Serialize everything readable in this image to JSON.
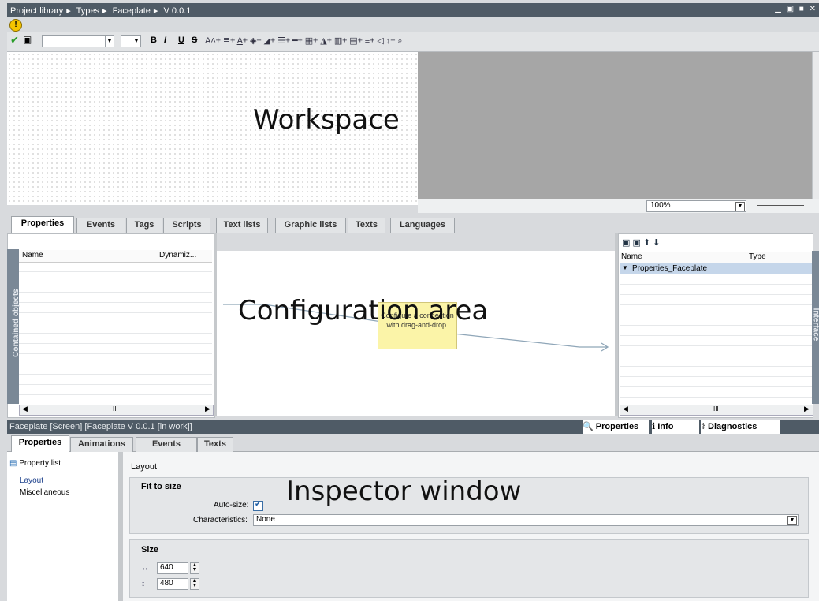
{
  "titlebar": {
    "crumbs": [
      "Project library",
      "Types",
      "Faceplate",
      "V 0.0.1"
    ],
    "sep": "▸",
    "controls": "▁ ▣ ■ ✕"
  },
  "toolbar": {
    "bold": "B",
    "italic": "I",
    "underline": "U",
    "strike": "S"
  },
  "workspace": {
    "label": "Workspace",
    "zoom": "100%"
  },
  "config_tabs": [
    "Properties",
    "Events",
    "Tags",
    "Scripts",
    "Text lists",
    "Graphic lists",
    "Texts",
    "Languages"
  ],
  "left_panel": {
    "strip_label": "Contained objects",
    "col_name": "Name",
    "col_dyn": "Dynamiz...",
    "scroll_mid": "III"
  },
  "config_label": "Configuration area",
  "tooltip": "Configure a connection with drag-and-drop.",
  "right_panel": {
    "strip_label": "Interface",
    "col_name": "Name",
    "col_type": "Type",
    "row": "Properties_Faceplate",
    "scroll_mid": "III"
  },
  "inspector": {
    "title": "Faceplate [Screen] [Faceplate V 0.0.1 [in work]]",
    "tabs": [
      "Properties",
      "Animations",
      "Events",
      "Texts"
    ],
    "right_tabs": [
      "Properties",
      "Info",
      "Diagnostics"
    ],
    "property_list": "Property list",
    "tree": [
      "Layout",
      "Miscellaneous"
    ],
    "section": "Layout",
    "fit": {
      "heading": "Fit to size",
      "autosize_label": "Auto-size:",
      "char_label": "Characteristics:",
      "char_value": "None"
    },
    "size": {
      "heading": "Size",
      "width": "640",
      "height": "480"
    },
    "label": "Inspector window"
  }
}
